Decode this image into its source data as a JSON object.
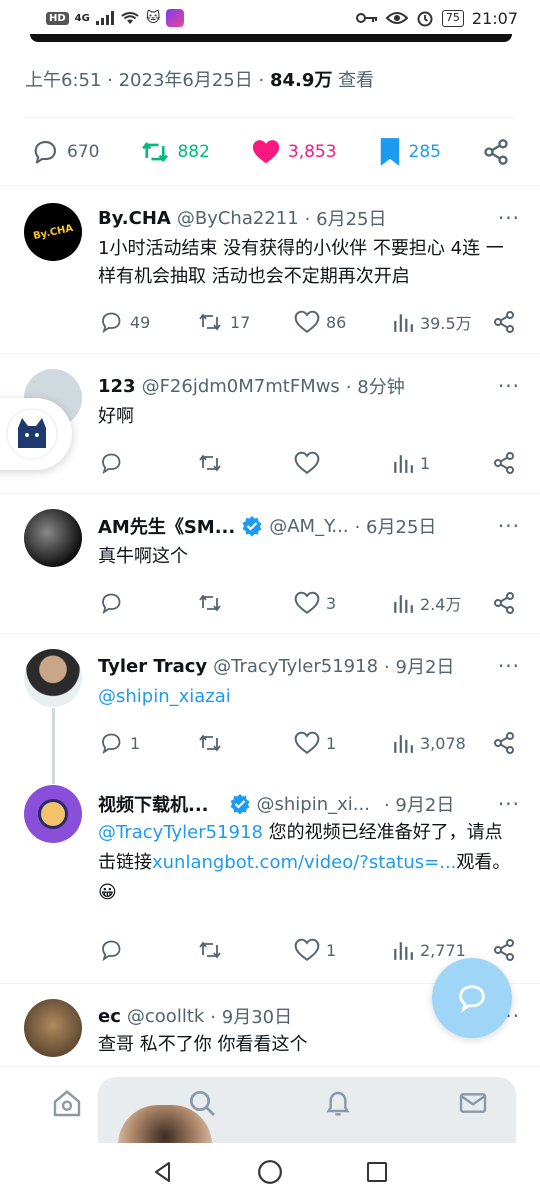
{
  "status_bar": {
    "network_chip": "HD",
    "network_type": "4G",
    "battery": "75",
    "time": "21:07"
  },
  "tweet_meta": {
    "time": "上午6:51",
    "date": "2023年6月25日",
    "views_count": "84.9万",
    "views_label": "查看"
  },
  "tweet_stats": {
    "replies": "670",
    "retweets": "882",
    "likes": "3,853",
    "bookmarks": "285"
  },
  "colors": {
    "retweet": "#00ba7c",
    "like": "#f91880",
    "bookmark": "#1d9bf0",
    "link": "#1d9bf0"
  },
  "replies": [
    {
      "name": "By.CHA",
      "handle": "@ByCha2211",
      "date": "· 6月25日",
      "text": "1小时活动结束 没有获得的小伙伴 不要担心 4连 一样有机会抽取 活动也会不定期再次开启",
      "avatar_text": "By.CHA",
      "replies": "49",
      "retweets": "17",
      "likes": "86",
      "views": "39.5万"
    },
    {
      "name": "123",
      "handle": "@F26jdm0M7mtFMws",
      "date": "· 8分钟",
      "text": "好啊",
      "replies": "",
      "retweets": "",
      "likes": "",
      "views": "1"
    },
    {
      "name": "AM先生《SM...",
      "handle": "@AM_Y...",
      "date": "· 6月25日",
      "text": "真牛啊这个",
      "replies": "",
      "retweets": "",
      "likes": "3",
      "views": "2.4万"
    },
    {
      "name": "Tyler Tracy",
      "handle": "@TracyTyler51918",
      "date": "· 9月2日",
      "text": "@shipin_xiazai",
      "replies": "1",
      "retweets": "",
      "likes": "1",
      "views": "3,078"
    },
    {
      "name": "视频下载机...",
      "handle": "@shipin_xi...",
      "date": "· 9月2日",
      "mention": "@TracyTyler51918",
      "text_a": " 您的视频已经准备好了，请点击链接",
      "link": "xunlangbot.com/video/?status=...",
      "text_b": "观看。",
      "emoji": "😀",
      "replies": "",
      "retweets": "",
      "likes": "1",
      "views": "2,771"
    },
    {
      "name": "ec",
      "handle": "@coolltk",
      "date": "· 9月30日",
      "text": "查哥 私不了你 你看看这个"
    }
  ],
  "more_glyph": "···"
}
